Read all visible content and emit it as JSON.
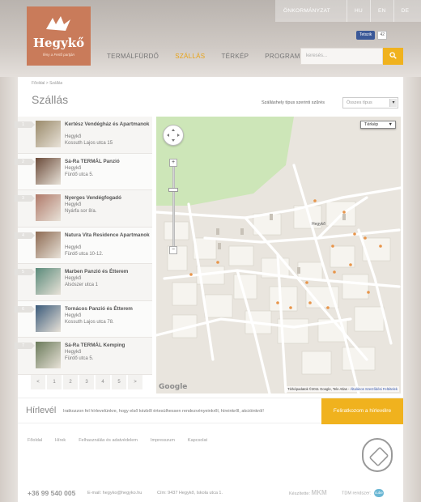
{
  "util": {
    "municipality": "ÖNKORMÁNYZAT",
    "langs": [
      "HU",
      "EN",
      "DE"
    ]
  },
  "social": {
    "fb_label": "Tetszik",
    "count": "42"
  },
  "logo": {
    "name": "Hegykő",
    "tagline": "fény a Fertő partján"
  },
  "nav": [
    {
      "label": "TERMÁLFÜRDŐ",
      "active": false
    },
    {
      "label": "SZÁLLÁS",
      "active": true
    },
    {
      "label": "TÉRKÉP",
      "active": false
    },
    {
      "label": "PROGRAMOK",
      "active": false
    }
  ],
  "search": {
    "placeholder": "keresés..."
  },
  "breadcrumb": "Főoldal > Szállás",
  "page_title": "Szállás",
  "filter": {
    "label": "Szálláshely típus szerinti szűrés",
    "value": "Összes típus"
  },
  "accommodations": [
    {
      "num": "1",
      "title": "Kertész Vendégház és Apartmanok",
      "town": "Hegykő",
      "street": "Kossuth Lajos utca 15",
      "color": "#9a8a6a"
    },
    {
      "num": "2",
      "title": "Sá-Ra TERMÁL Panzió",
      "town": "Hegykő",
      "street": "Fürdő utca 5.",
      "color": "#6b4b3a"
    },
    {
      "num": "3",
      "title": "Nyerges Vendégfogadó",
      "town": "Hegykő",
      "street": "Nyárfa sor 8/a.",
      "color": "#b07a6a"
    },
    {
      "num": "4",
      "title": "Natura Vita Residence Apartmanok",
      "town": "Hegykő",
      "street": "Fürdő utca 10-12.",
      "color": "#8d6a52"
    },
    {
      "num": "5",
      "title": "Marben Panzió és Étterem",
      "town": "Hegykő",
      "street": "Alsószer utca 1",
      "color": "#5a8a7a"
    },
    {
      "num": "6",
      "title": "Tornácos Panzió és Étterem",
      "town": "Hegykő",
      "street": "Kossuth Lajos utca 78.",
      "color": "#3a5a7a"
    },
    {
      "num": "7",
      "title": "Sá-Ra TERMÁL Kemping",
      "town": "Hegykő",
      "street": "Fürdő utca 5.",
      "color": "#6a7a5a"
    }
  ],
  "pager": [
    "<",
    "1",
    "2",
    "3",
    "4",
    "5",
    ">"
  ],
  "map": {
    "type_label": "Térkép",
    "google": "Google",
    "attribution": "Térképadatok ©2011 Google, Tele Atlas -",
    "terms": "Általános Szerződési Feltételek",
    "town_label": "Hegykő"
  },
  "newsletter": {
    "title": "Hírlevél",
    "text": "Iratkozzon fel hírlevelünkre, hogy első kézből értesülhessen rendezvényeinkről, híreinkről, akcióinkról!",
    "button": "Feliratkozom a hírlevélre"
  },
  "footer": {
    "links": [
      "Főoldal",
      "Hírek",
      "Felhasználás és adatvédelem",
      "Impresszum",
      "Kapcsolat"
    ],
    "phone": "+36 99 540 005",
    "email": "E-mail: hegyko@hegyko.hu",
    "address": "Cím: 9437 Hegykő, Iskola utca 1.",
    "made_by": "Készítette:",
    "made_logo": "MKM",
    "tdm": "TDM rendszer:",
    "tdm_logo": "cube"
  }
}
